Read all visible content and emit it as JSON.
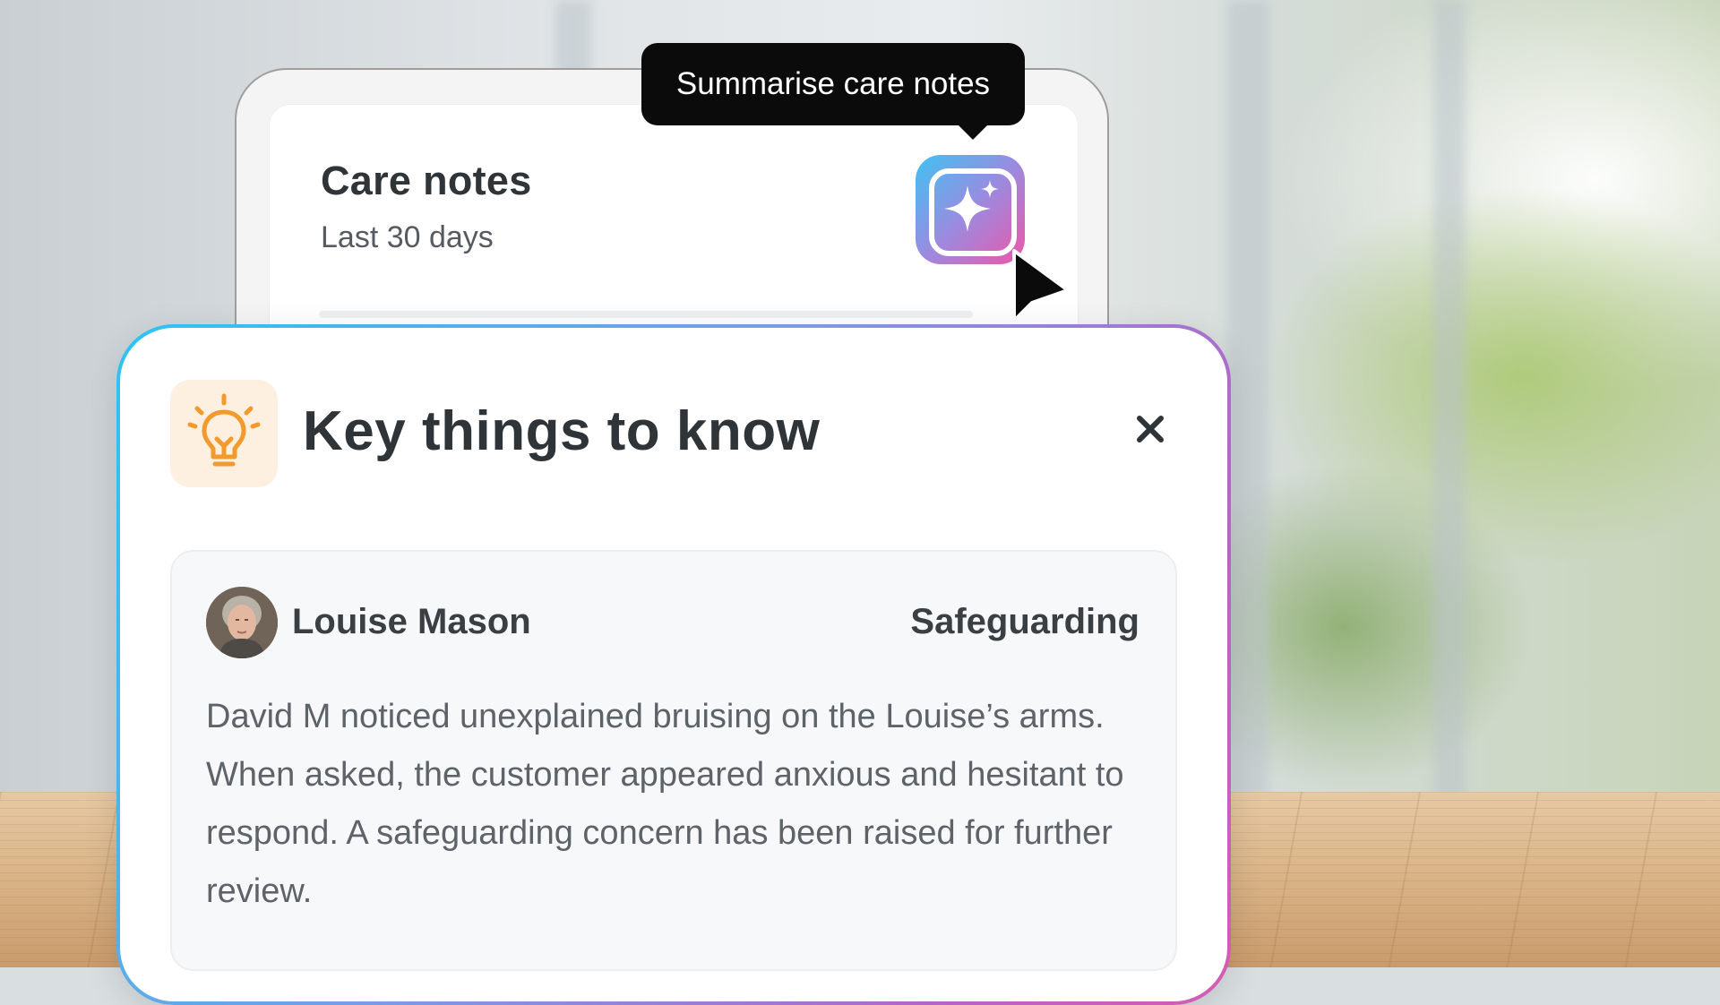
{
  "tooltip": {
    "text": "Summarise care notes"
  },
  "care_notes": {
    "title": "Care notes",
    "subtitle": "Last 30 days",
    "summarise_icon": "sparkle-icon"
  },
  "key_things": {
    "title": "Key things to know",
    "icon": "lightbulb-icon",
    "close_icon": "close-icon",
    "note": {
      "person_name": "Louise Mason",
      "category": "Safeguarding",
      "body": "David M noticed unexplained bruising on the Louise’s arms. When asked, the customer appeared anxious and hesitant to respond. A safeguarding concern has been raised for further review."
    }
  },
  "colors": {
    "accent_gradient_start": "#3ec3f2",
    "accent_gradient_end": "#ee56a8",
    "bulb_orange": "#f39a2c",
    "tile_cream": "#fdf0e0",
    "text_dark": "#2f3438"
  }
}
